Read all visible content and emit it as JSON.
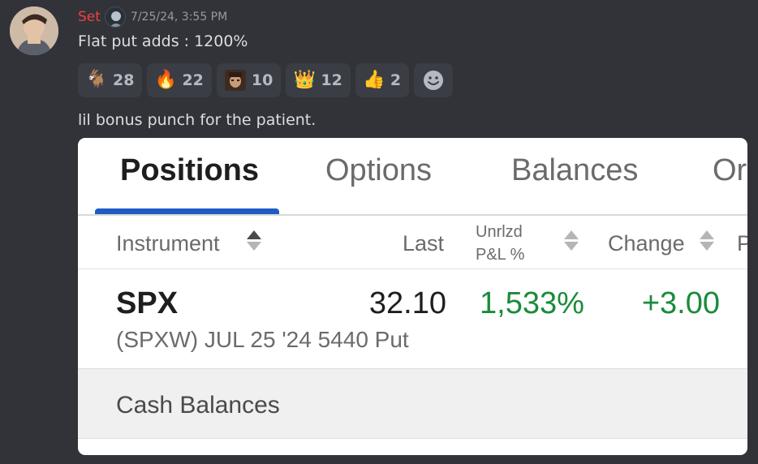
{
  "message": {
    "username": "Set",
    "timestamp": "7/25/24, 3:55 PM",
    "line1": "Flat put adds : 1200%",
    "line2": "lil bonus punch for the patient."
  },
  "reactions": [
    {
      "emoji": "goat",
      "glyph": "🐐",
      "count": "28"
    },
    {
      "emoji": "fire",
      "glyph": "🔥",
      "count": "22"
    },
    {
      "emoji": "custom-face",
      "glyph": "",
      "count": "10"
    },
    {
      "emoji": "crown",
      "glyph": "👑",
      "count": "12"
    },
    {
      "emoji": "thumbs-up",
      "glyph": "👍",
      "count": "2"
    }
  ],
  "card": {
    "tabs": [
      "Positions",
      "Options",
      "Balances",
      "Or"
    ],
    "active_tab": "Positions",
    "columns": {
      "instrument": "Instrument",
      "last": "Last",
      "unrlzd_line1": "Unrlzd",
      "unrlzd_line2": "P&L %",
      "change": "Change",
      "next": "P"
    },
    "position": {
      "symbol": "SPX",
      "description": "(SPXW) JUL 25 '24 5440 Put",
      "last": "32.10",
      "pnl_pct": "1,533%",
      "change": "+3.00"
    },
    "cash_balances": "Cash Balances"
  },
  "colors": {
    "background": "#313338",
    "username": "#f23f43",
    "gain": "#1a8b3c",
    "tab_accent": "#1f5bc4"
  }
}
